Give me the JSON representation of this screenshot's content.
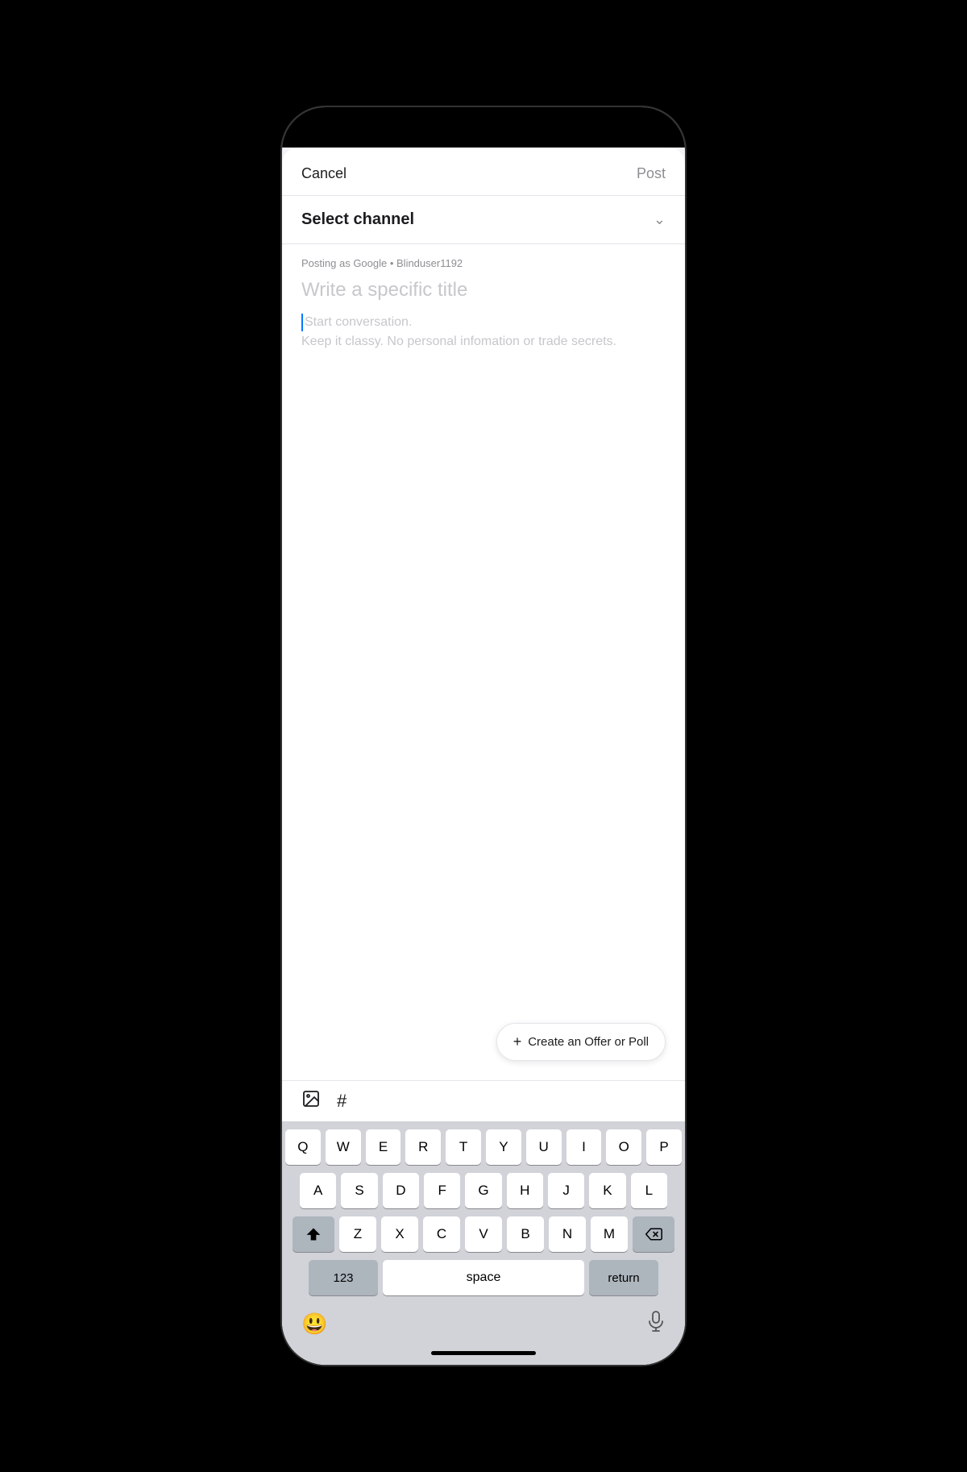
{
  "header": {
    "cancel_label": "Cancel",
    "post_label": "Post"
  },
  "channel": {
    "label": "Select channel",
    "chevron": "⌄"
  },
  "post": {
    "posting_as": "Posting as Google • Blinduser1192",
    "title_placeholder": "Write a specific title",
    "body_placeholder_line1": "Start conversation.",
    "body_placeholder_line2": "Keep it classy. No personal infomation or trade secrets."
  },
  "create_offer_btn": {
    "label": "Create an Offer or Poll",
    "plus": "+"
  },
  "toolbar": {
    "image_icon": "🖼",
    "hashtag_icon": "#"
  },
  "keyboard": {
    "row1": [
      "Q",
      "W",
      "E",
      "R",
      "T",
      "Y",
      "U",
      "I",
      "O",
      "P"
    ],
    "row2": [
      "A",
      "S",
      "D",
      "F",
      "G",
      "H",
      "J",
      "K",
      "L"
    ],
    "row3": [
      "Z",
      "X",
      "C",
      "V",
      "B",
      "N",
      "M"
    ],
    "num_label": "123",
    "space_label": "space",
    "return_label": "return"
  }
}
